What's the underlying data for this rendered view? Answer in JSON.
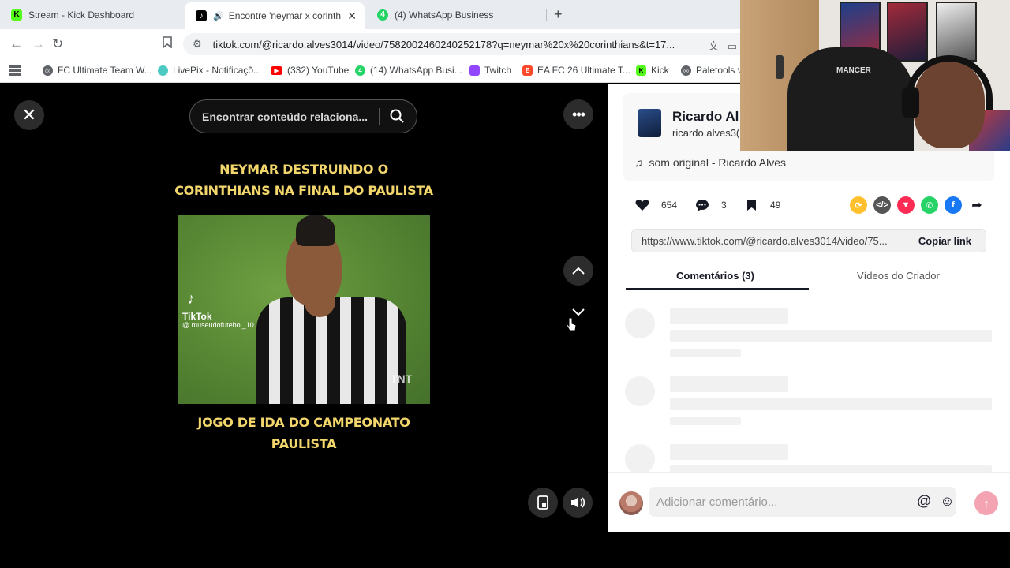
{
  "browser": {
    "tabs": [
      {
        "title": "Stream - Kick Dashboard",
        "icon": "kick-icon",
        "color": "#53fc18"
      },
      {
        "title": "Encontre 'neymar x corinthians",
        "icon": "tiktok-icon",
        "color": "#000000",
        "active": true
      },
      {
        "title": "(4) WhatsApp Business",
        "icon": "whatsapp-icon",
        "color": "#25d366"
      }
    ],
    "url": "tiktok.com/@ricardo.alves3014/video/7582002460240252178?q=neymar%20x%20corinthians&t=17...",
    "bookmarks": [
      {
        "label": "FC Ultimate Team W...",
        "icon": "globe-icon"
      },
      {
        "label": "LivePix - Notificaçõ...",
        "icon": "livepix-icon"
      },
      {
        "label": "(332) YouTube",
        "icon": "youtube-icon"
      },
      {
        "label": "(14) WhatsApp Busi...",
        "icon": "whatsapp-icon"
      },
      {
        "label": "Twitch",
        "icon": "twitch-icon"
      },
      {
        "label": "EA FC 26 Ultimate T...",
        "icon": "ea-icon"
      },
      {
        "label": "Kick",
        "icon": "kick-icon"
      },
      {
        "label": "Paletools v",
        "icon": "globe-icon"
      }
    ]
  },
  "video": {
    "search_placeholder": "Encontrar conteúdo relaciona...",
    "caption_top": [
      "NEYMAR DESTRUINDO O",
      "CORINTHIANS NA FINAL DO PAULISTA"
    ],
    "caption_bottom": [
      "JOGO DE IDA DO CAMPEONATO",
      "PAULISTA"
    ],
    "watermark": {
      "brand": "TikTok",
      "user": "@ museudofutebol_10"
    },
    "corner_mark": "TNT"
  },
  "panel": {
    "creator_name": "Ricardo Al",
    "creator_handle": "ricardo.alves3(",
    "music": "som original - Ricardo Alves",
    "likes": "654",
    "comments": "3",
    "saves": "49",
    "link": "https://www.tiktok.com/@ricardo.alves3014/video/75...",
    "copy_label": "Copiar link",
    "tab_comments": "Comentários (3)",
    "tab_videos": "Vídeos do Criador",
    "comment_placeholder": "Adicionar comentário..."
  },
  "webcam": {
    "chair_label": "MANCER"
  }
}
